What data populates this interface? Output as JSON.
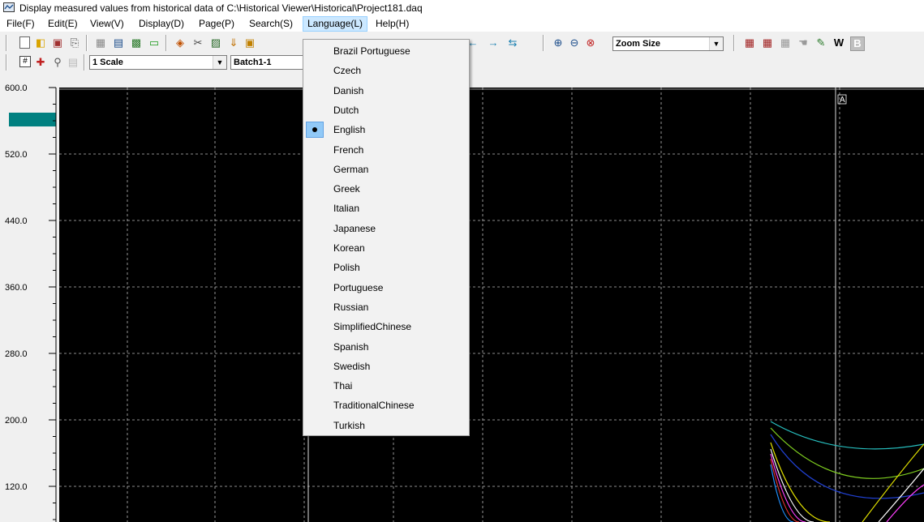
{
  "window": {
    "title": "Display measured values from historical data of C:\\Historical Viewer\\Historical\\Project181.daq"
  },
  "menubar": {
    "items": [
      "File(F)",
      "Edit(E)",
      "View(V)",
      "Display(D)",
      "Page(P)",
      "Search(S)",
      "Language(L)",
      "Help(H)"
    ]
  },
  "toolbar": {
    "zoom_combo": "Zoom Size",
    "scale_combo": "1 Scale",
    "batch_combo": "Batch1-1",
    "w_label": "W",
    "b_label": "B"
  },
  "chart_data": {
    "type": "line",
    "y_tick_labels": [
      "600.0",
      "520.0",
      "440.0",
      "360.0",
      "280.0",
      "200.0",
      "120.0"
    ],
    "cursor_label": "A",
    "grid": true,
    "background": "#000000"
  },
  "language_menu": {
    "items": [
      "Brazil Portuguese",
      "Czech",
      "Danish",
      "Dutch",
      "English",
      "French",
      "German",
      "Greek",
      "Italian",
      "Japanese",
      "Korean",
      "Polish",
      "Portuguese",
      "Russian",
      "SimplifiedChinese",
      "Spanish",
      "Swedish",
      "Thai",
      "TraditionalChinese",
      "Turkish"
    ],
    "selected": "English"
  },
  "colors": {
    "plot_bg": "#000000",
    "menu_highlight": "#cce8ff",
    "teal": "#008080"
  }
}
